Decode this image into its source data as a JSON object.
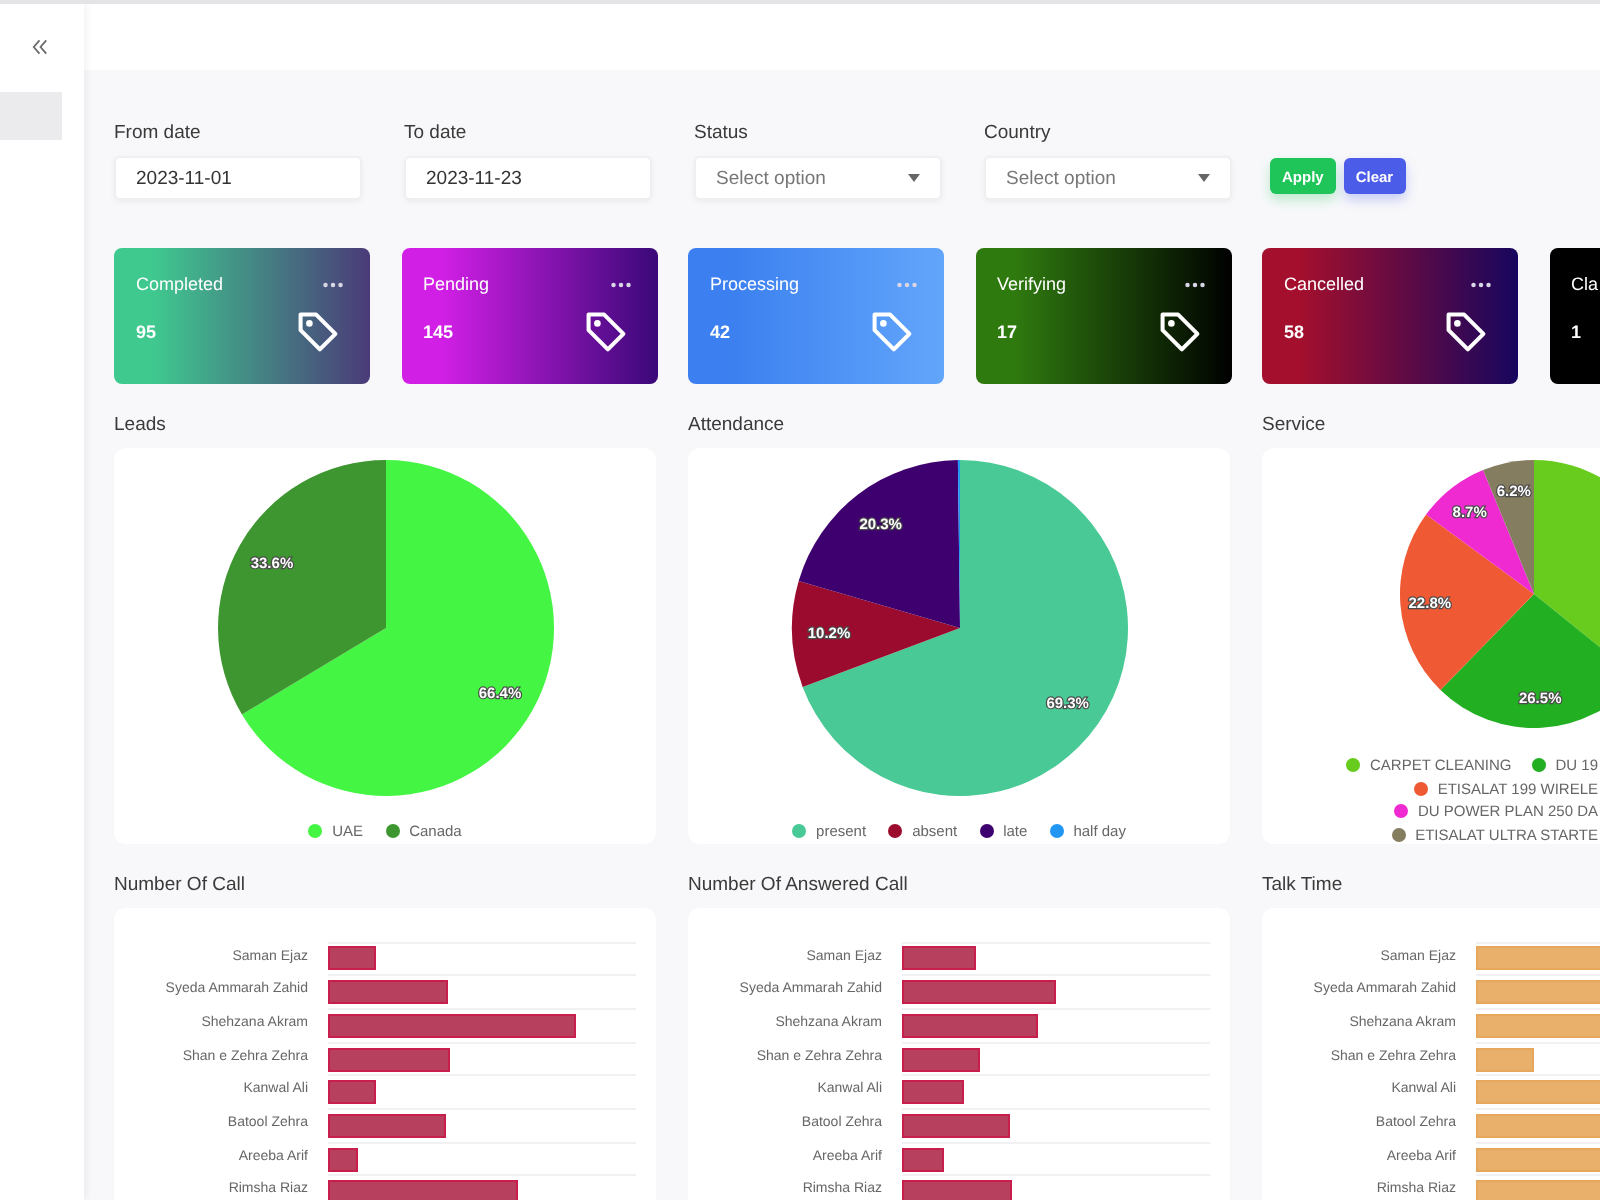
{
  "sidebar": {
    "items": [
      {
        "selected": true
      }
    ]
  },
  "filters": [
    {
      "kind": "date",
      "label": "From date",
      "value": "2023-11-01"
    },
    {
      "kind": "date",
      "label": "To date",
      "value": "2023-11-23"
    },
    {
      "kind": "select",
      "label": "Status",
      "placeholder": "Select option"
    },
    {
      "kind": "select",
      "label": "Country",
      "placeholder": "Select option"
    }
  ],
  "buttons": [
    {
      "kind": "apply",
      "label": "Apply"
    },
    {
      "kind": "clear",
      "label": "Clear"
    }
  ],
  "cards": [
    {
      "title": "Completed",
      "value": "95",
      "gradient": [
        {
          "color": "#3fc98f"
        },
        {
          "color": "#4a3b78"
        }
      ]
    },
    {
      "title": "Pending",
      "value": "145",
      "gradient": [
        {
          "color": "#d21fe6"
        },
        {
          "color": "#3a0878"
        }
      ]
    },
    {
      "title": "Processing",
      "value": "42",
      "gradient": [
        {
          "color": "#3b7ff0"
        },
        {
          "color": "#62a6fb"
        }
      ]
    },
    {
      "title": "Verifying",
      "value": "17",
      "gradient": [
        {
          "color": "#2f7a0f"
        },
        {
          "color": "#000000"
        }
      ]
    },
    {
      "title": "Cancelled",
      "value": "58",
      "gradient": [
        {
          "color": "#a30f2d"
        },
        {
          "color": "#17065e"
        }
      ]
    },
    {
      "title": "Cla",
      "value": "1",
      "gradient": [
        {
          "color": "#000000"
        },
        {
          "color": "#000000"
        }
      ]
    }
  ],
  "pie_charts": [
    {
      "title": "Leads",
      "chart_data": {
        "type": "pie",
        "categories": [
          "UAE",
          "Canada"
        ],
        "values": [
          66.4,
          33.6
        ],
        "colors": [
          "#44f544",
          "#3d962f"
        ],
        "value_labels": [
          "66.4%",
          "33.6%"
        ],
        "legend": "bottom"
      }
    },
    {
      "title": "Attendance",
      "chart_data": {
        "type": "pie",
        "categories": [
          "present",
          "absent",
          "late",
          "half day"
        ],
        "values": [
          69.3,
          10.2,
          20.3,
          0.2
        ],
        "colors": [
          "#48c995",
          "#9b0b2e",
          "#3f006f",
          "#2196f3"
        ],
        "value_labels": [
          "69.3%",
          "10.2%",
          "20.3%",
          null
        ],
        "legend": "bottom"
      }
    },
    {
      "title": "Service",
      "chart_data": {
        "type": "pie",
        "categories": [
          "CARPET CLEANING",
          "DU 19",
          "ETISALAT 199 WIRELE",
          "DU POWER PLAN 250 DA",
          "ETISALAT ULTRA STARTE"
        ],
        "values": [
          35.8,
          26.5,
          22.8,
          8.7,
          6.2
        ],
        "colors": [
          "#67cc1e",
          "#22b022",
          "#ef5a35",
          "#ee2ad0",
          "#857d60"
        ],
        "value_labels": [
          null,
          "26.5%",
          "22.8%",
          "8.7%",
          "6.2%"
        ],
        "legend": "bottom"
      }
    }
  ],
  "bar_charts": [
    {
      "title": "Number Of Call",
      "labels": [
        "Saman Ejaz",
        "Syeda Ammarah Zahid",
        "Shehzana Akram",
        "Shan e Zehra Zehra",
        "Kanwal Ali",
        "Batool Zehra",
        "Areeba Arif",
        "Rimsha Riaz"
      ]
    },
    {
      "title": "Number Of Answered Call",
      "labels": [
        "Saman Ejaz",
        "Syeda Ammarah Zahid",
        "Shehzana Akram",
        "Shan e Zehra Zehra",
        "Kanwal Ali",
        "Batool Zehra",
        "Areeba Arif",
        "Rimsha Riaz"
      ]
    },
    {
      "title": "Talk Time",
      "labels": [
        "Saman Ejaz",
        "Syeda Ammarah Zahid",
        "Shehzana Akram",
        "Shan e Zehra Zehra",
        "Kanwal Ali",
        "Batool Zehra",
        "Areeba Arif",
        "Rimsha Riaz"
      ]
    }
  ]
}
